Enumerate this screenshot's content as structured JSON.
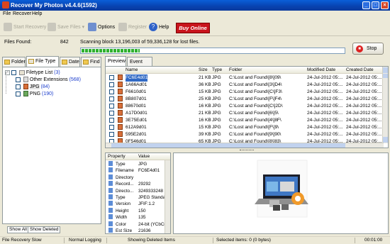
{
  "window": {
    "title": "Recover My Photos v4.4.6(1592)",
    "minimize": "_",
    "maximize": "□",
    "close": "×"
  },
  "menu": [
    "File",
    "Recover",
    "Help"
  ],
  "toolbar": {
    "start_recovery": "Start Recovery",
    "save_files": "Save Files",
    "options": "Options",
    "register": "Register",
    "help": "Help",
    "buy_online": "Buy Online"
  },
  "scan": {
    "files_found_label": "Files Found:",
    "files_found_value": "842",
    "status_text": "Scanning block 13,196,003 of 59,336,128 for lost files.",
    "progress_fraction": 0.22,
    "stop_label": "Stop"
  },
  "left_tabs": [
    "Folder",
    "File Type",
    "Date",
    "Find"
  ],
  "tree": {
    "root_label": "Filetype List",
    "root_count": "(3)",
    "items": [
      {
        "label": "Other Extensions",
        "count": "(568)"
      },
      {
        "label": "JPG",
        "count": "(84)"
      },
      {
        "label": "PNG",
        "count": "(190)"
      }
    ]
  },
  "left_buttons": {
    "show_all": "Show All",
    "show_deleted": "Show Deleted"
  },
  "right_tabs": [
    "Preview",
    "Event Log"
  ],
  "file_table": {
    "columns": [
      "Name",
      "Size",
      "Type",
      "Folder",
      "Modified Date",
      "Created Date",
      "A"
    ],
    "rows": [
      {
        "name": "FC6E4d01",
        "size": "21 KB",
        "type": "JPG",
        "folder": "C:\\Lost and Found\\[8\\]09\\",
        "modified": "24-Jul-2012 05:...",
        "created": "24-Jul-2012 05:..."
      },
      {
        "name": "1A66Ad01",
        "size": "36 KB",
        "type": "JPG",
        "folder": "C:\\Lost and Found\\[3\\]D4\\",
        "modified": "24-Jul-2012 05:...",
        "created": "24-Jul-2012 05:..."
      },
      {
        "name": "F6610d01",
        "size": "15 KB",
        "type": "JPG",
        "folder": "C:\\Lost and Found\\[C\\]F3\\",
        "modified": "24-Jul-2012 05:...",
        "created": "24-Jul-2012 05:..."
      },
      {
        "name": "8B807d01",
        "size": "25 KB",
        "type": "JPG",
        "folder": "C:\\Lost and Found\\[F\\]F4\\",
        "modified": "24-Jul-2012 05:...",
        "created": "24-Jul-2012 05:..."
      },
      {
        "name": "88670d01",
        "size": "16 KB",
        "type": "JPG",
        "folder": "C:\\Lost and Found\\[C\\]2D\\",
        "modified": "24-Jul-2012 05:...",
        "created": "24-Jul-2012 05:..."
      },
      {
        "name": "A17D0d01",
        "size": "21 KB",
        "type": "JPG",
        "folder": "C:\\Lost and Found\\[6\\]5\\",
        "modified": "24-Jul-2012 05:...",
        "created": "24-Jul-2012 05:..."
      },
      {
        "name": "3E75Ed01",
        "size": "16 KB",
        "type": "JPG",
        "folder": "C:\\Lost and Found\\[4\\]8F\\",
        "modified": "24-Jul-2012 05:...",
        "created": "24-Jul-2012 05:..."
      },
      {
        "name": "612A9d01",
        "size": "15 KB",
        "type": "JPG",
        "folder": "C:\\Lost and Found\\[F\\]9\\",
        "modified": "24-Jul-2012 05:...",
        "created": "24-Jul-2012 05:..."
      },
      {
        "name": "595E2d01",
        "size": "39 KB",
        "type": "JPG",
        "folder": "C:\\Lost and Found\\[9\\]90\\",
        "modified": "24-Jul-2012 05:...",
        "created": "24-Jul-2012 05:..."
      },
      {
        "name": "0F546d01",
        "size": "65 KB",
        "type": "JPG",
        "folder": "C:\\Lost and Found\\[8\\]83\\",
        "modified": "24-Jul-2012 05:...",
        "created": "24-Jul-2012 05:..."
      }
    ]
  },
  "properties": {
    "headers": [
      "Property",
      "Value"
    ],
    "rows": [
      {
        "property": "Type",
        "value": "JPG"
      },
      {
        "property": "Filename",
        "value": "FC6E4d01"
      },
      {
        "property": "Directory",
        "value": ""
      },
      {
        "property": "Record...",
        "value": "29292"
      },
      {
        "property": "Directo...",
        "value": "3249333248"
      },
      {
        "property": "Type",
        "value": "JPEG Standa..."
      },
      {
        "property": "Version",
        "value": "JFIF:1.2"
      },
      {
        "property": "Height",
        "value": "150"
      },
      {
        "property": "Width",
        "value": "135"
      },
      {
        "property": "Color",
        "value": "24-bit (YCbCr..."
      },
      {
        "property": "Est Size",
        "value": "21636"
      }
    ]
  },
  "status_bar": {
    "left": "File Recovery Slow",
    "logging": "Normal Logging",
    "showing": "Showing Deleted Items",
    "selected": "Selected items: 0 (0 bytes)",
    "time": "00:01:00"
  }
}
